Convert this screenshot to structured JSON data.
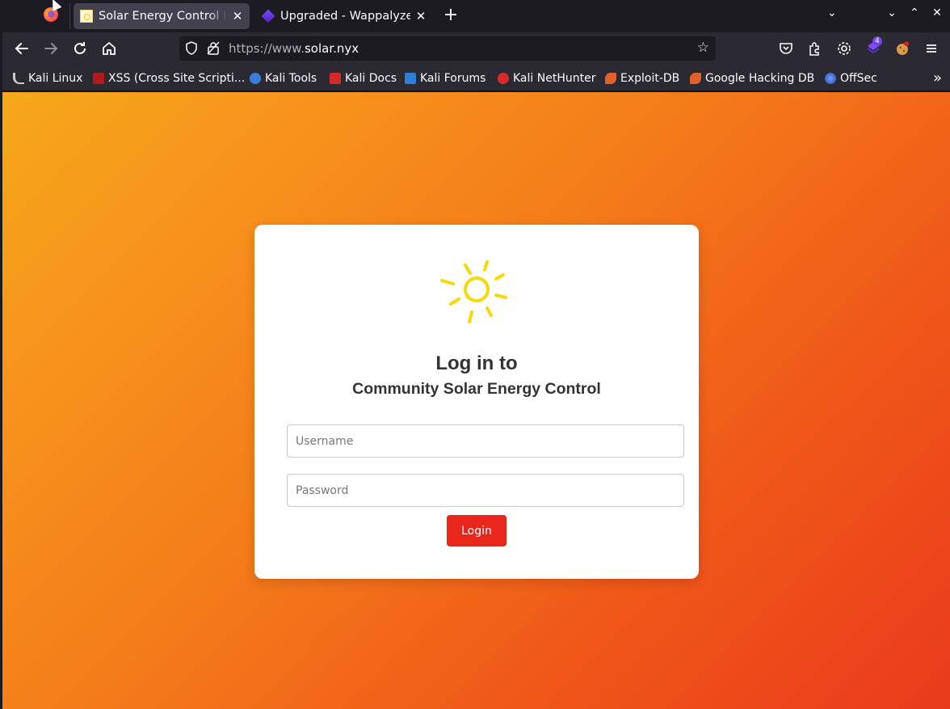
{
  "browser": {
    "tabs": [
      {
        "title": "Solar Energy Control Login",
        "icon": "sun-favicon",
        "active": true
      },
      {
        "title": "Upgraded - Wappalyzer",
        "icon": "wappalyzer-favicon",
        "active": false
      }
    ],
    "url": {
      "prefix": "https://www.",
      "domain": "solar.nyx"
    },
    "extension_badge": "4",
    "bookmarks": [
      {
        "label": "Kali Linux",
        "icon": "kali-dragon-icon",
        "color": "#cccccc"
      },
      {
        "label": "XSS (Cross Site Scripti...",
        "icon": "xss-icon",
        "color": "#b31b1b"
      },
      {
        "label": "Kali Tools",
        "icon": "kali-tools-icon",
        "color": "#3b7ddd"
      },
      {
        "label": "Kali Docs",
        "icon": "kali-docs-icon",
        "color": "#d42a2a"
      },
      {
        "label": "Kali Forums",
        "icon": "kali-forums-icon",
        "color": "#2e7fd8"
      },
      {
        "label": "Kali NetHunter",
        "icon": "nethunter-icon",
        "color": "#d62c2c"
      },
      {
        "label": "Exploit-DB",
        "icon": "exploit-db-icon",
        "color": "#e0622a"
      },
      {
        "label": "Google Hacking DB",
        "icon": "ghdb-icon",
        "color": "#e0622a"
      },
      {
        "label": "OffSec",
        "icon": "offsec-icon",
        "color": "#3a62c4"
      }
    ]
  },
  "login": {
    "title": "Log in to",
    "subtitle": "Community Solar Energy Control",
    "username_placeholder": "Username",
    "password_placeholder": "Password",
    "button_label": "Login"
  },
  "colors": {
    "accent": "#e8261c",
    "sun": "#f5d90a",
    "gradient_start": "#f6a81a",
    "gradient_end": "#ea3a1c"
  }
}
